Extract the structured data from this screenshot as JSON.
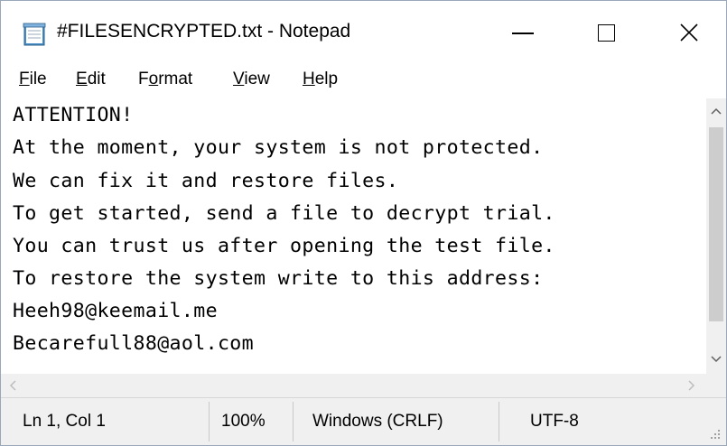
{
  "window": {
    "title": "#FILESENCRYPTED.txt - Notepad",
    "icon": "notepad-icon",
    "controls": [
      "minimize-icon",
      "maximize-icon",
      "close-icon"
    ]
  },
  "menu": {
    "items": [
      {
        "first": "F",
        "rest": "ile"
      },
      {
        "first": "E",
        "rest": "dit"
      },
      {
        "before": "F",
        "first": "o",
        "rest": "rmat"
      },
      {
        "first": "V",
        "rest": "iew"
      },
      {
        "first": "H",
        "rest": "elp"
      }
    ]
  },
  "document": {
    "lines": [
      "ATTENTION!",
      "At the moment, your system is not protected.",
      "We can fix it and restore files.",
      "To get started, send a file to decrypt trial.",
      "You can trust us after opening the test file.",
      "To restore the system write to this address:",
      "Heeh98@keemail.me",
      "Becarefull88@aol.com"
    ]
  },
  "status": {
    "position": "Ln 1, Col 1",
    "zoom": "100%",
    "line_ending": "Windows (CRLF)",
    "encoding": "UTF-8"
  }
}
